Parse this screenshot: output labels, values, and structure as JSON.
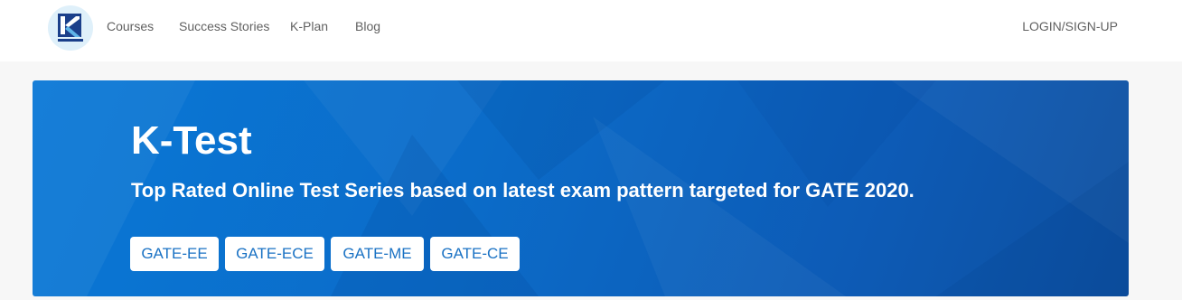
{
  "nav": {
    "logo_icon": "k-logo-icon",
    "links": [
      "Courses",
      "Success Stories",
      "K-Plan",
      "Blog"
    ],
    "login": "LOGIN/SIGN-UP"
  },
  "hero": {
    "title": "K-Test",
    "subtitle": "Top Rated Online Test Series based on latest exam pattern targeted for GATE 2020.",
    "buttons": [
      "GATE-EE",
      "GATE-ECE",
      "GATE-ME",
      "GATE-CE"
    ]
  },
  "colors": {
    "hero_start": "#0a78d6",
    "hero_end": "#0d4f9f",
    "button_text": "#1a72c4",
    "nav_text": "#616161",
    "logo_bg": "#dff0fa"
  }
}
